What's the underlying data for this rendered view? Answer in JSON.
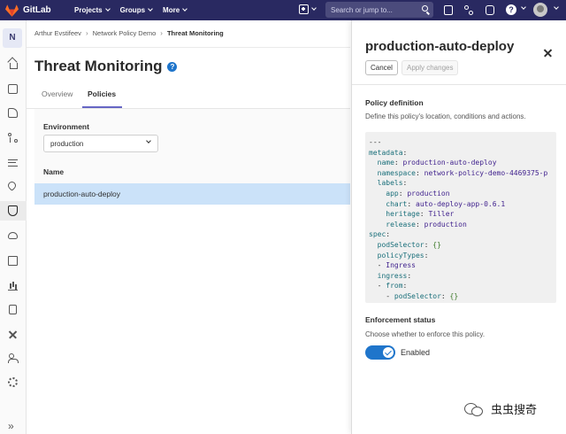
{
  "topbar": {
    "brand": "GitLab",
    "menu": [
      "Projects",
      "Groups",
      "More"
    ],
    "search_placeholder": "Search or jump to...",
    "help": "?"
  },
  "sidebar": {
    "project_initial": "N",
    "collapse": "»"
  },
  "breadcrumb": [
    "Arthur Evstifeev",
    "Network Policy Demo",
    "Threat Monitoring"
  ],
  "breadcrumb_sep": "›",
  "page": {
    "title": "Threat Monitoring",
    "help_icon": "?",
    "tabs": [
      "Overview",
      "Policies"
    ],
    "active_tab": "Policies",
    "environment_label": "Environment",
    "environment_value": "production",
    "column_name": "Name",
    "rows": [
      "production-auto-deploy"
    ]
  },
  "drawer": {
    "title": "production-auto-deploy",
    "cancel_label": "Cancel",
    "apply_label": "Apply changes",
    "policy_title": "Policy definition",
    "policy_desc": "Define this policy's location, conditions and actions.",
    "enforcement_title": "Enforcement status",
    "enforcement_desc": "Choose whether to enforce this policy.",
    "toggle_label": "Enabled",
    "toggle_on": true
  },
  "code": {
    "line1": "---",
    "line2_key": "metadata",
    "line3_key": "name",
    "line3_val": "production-auto-deploy",
    "line4_key": "namespace",
    "line4_val": "network-policy-demo-4469375-p",
    "line5_key": "labels",
    "line6_key": "app",
    "line6_val": "production",
    "line7_key": "chart",
    "line7_val": "auto-deploy-app-0.6.1",
    "line8_key": "heritage",
    "line8_val": "Tiller",
    "line9_key": "release",
    "line9_val": "production",
    "line10_key": "spec",
    "line11_key": "podSelector",
    "line11_val": "{}",
    "line12_key": "policyTypes",
    "line13_val": "Ingress",
    "line14_key": "ingress",
    "line15_key": "from",
    "line16_key": "podSelector",
    "line16_val": "{}"
  },
  "watermark": "虫虫搜奇",
  "colors": {
    "navbar": "#292961",
    "accent": "#1f75cb",
    "selected_row": "#cbe2f9",
    "tab_underline": "#6666c4"
  }
}
